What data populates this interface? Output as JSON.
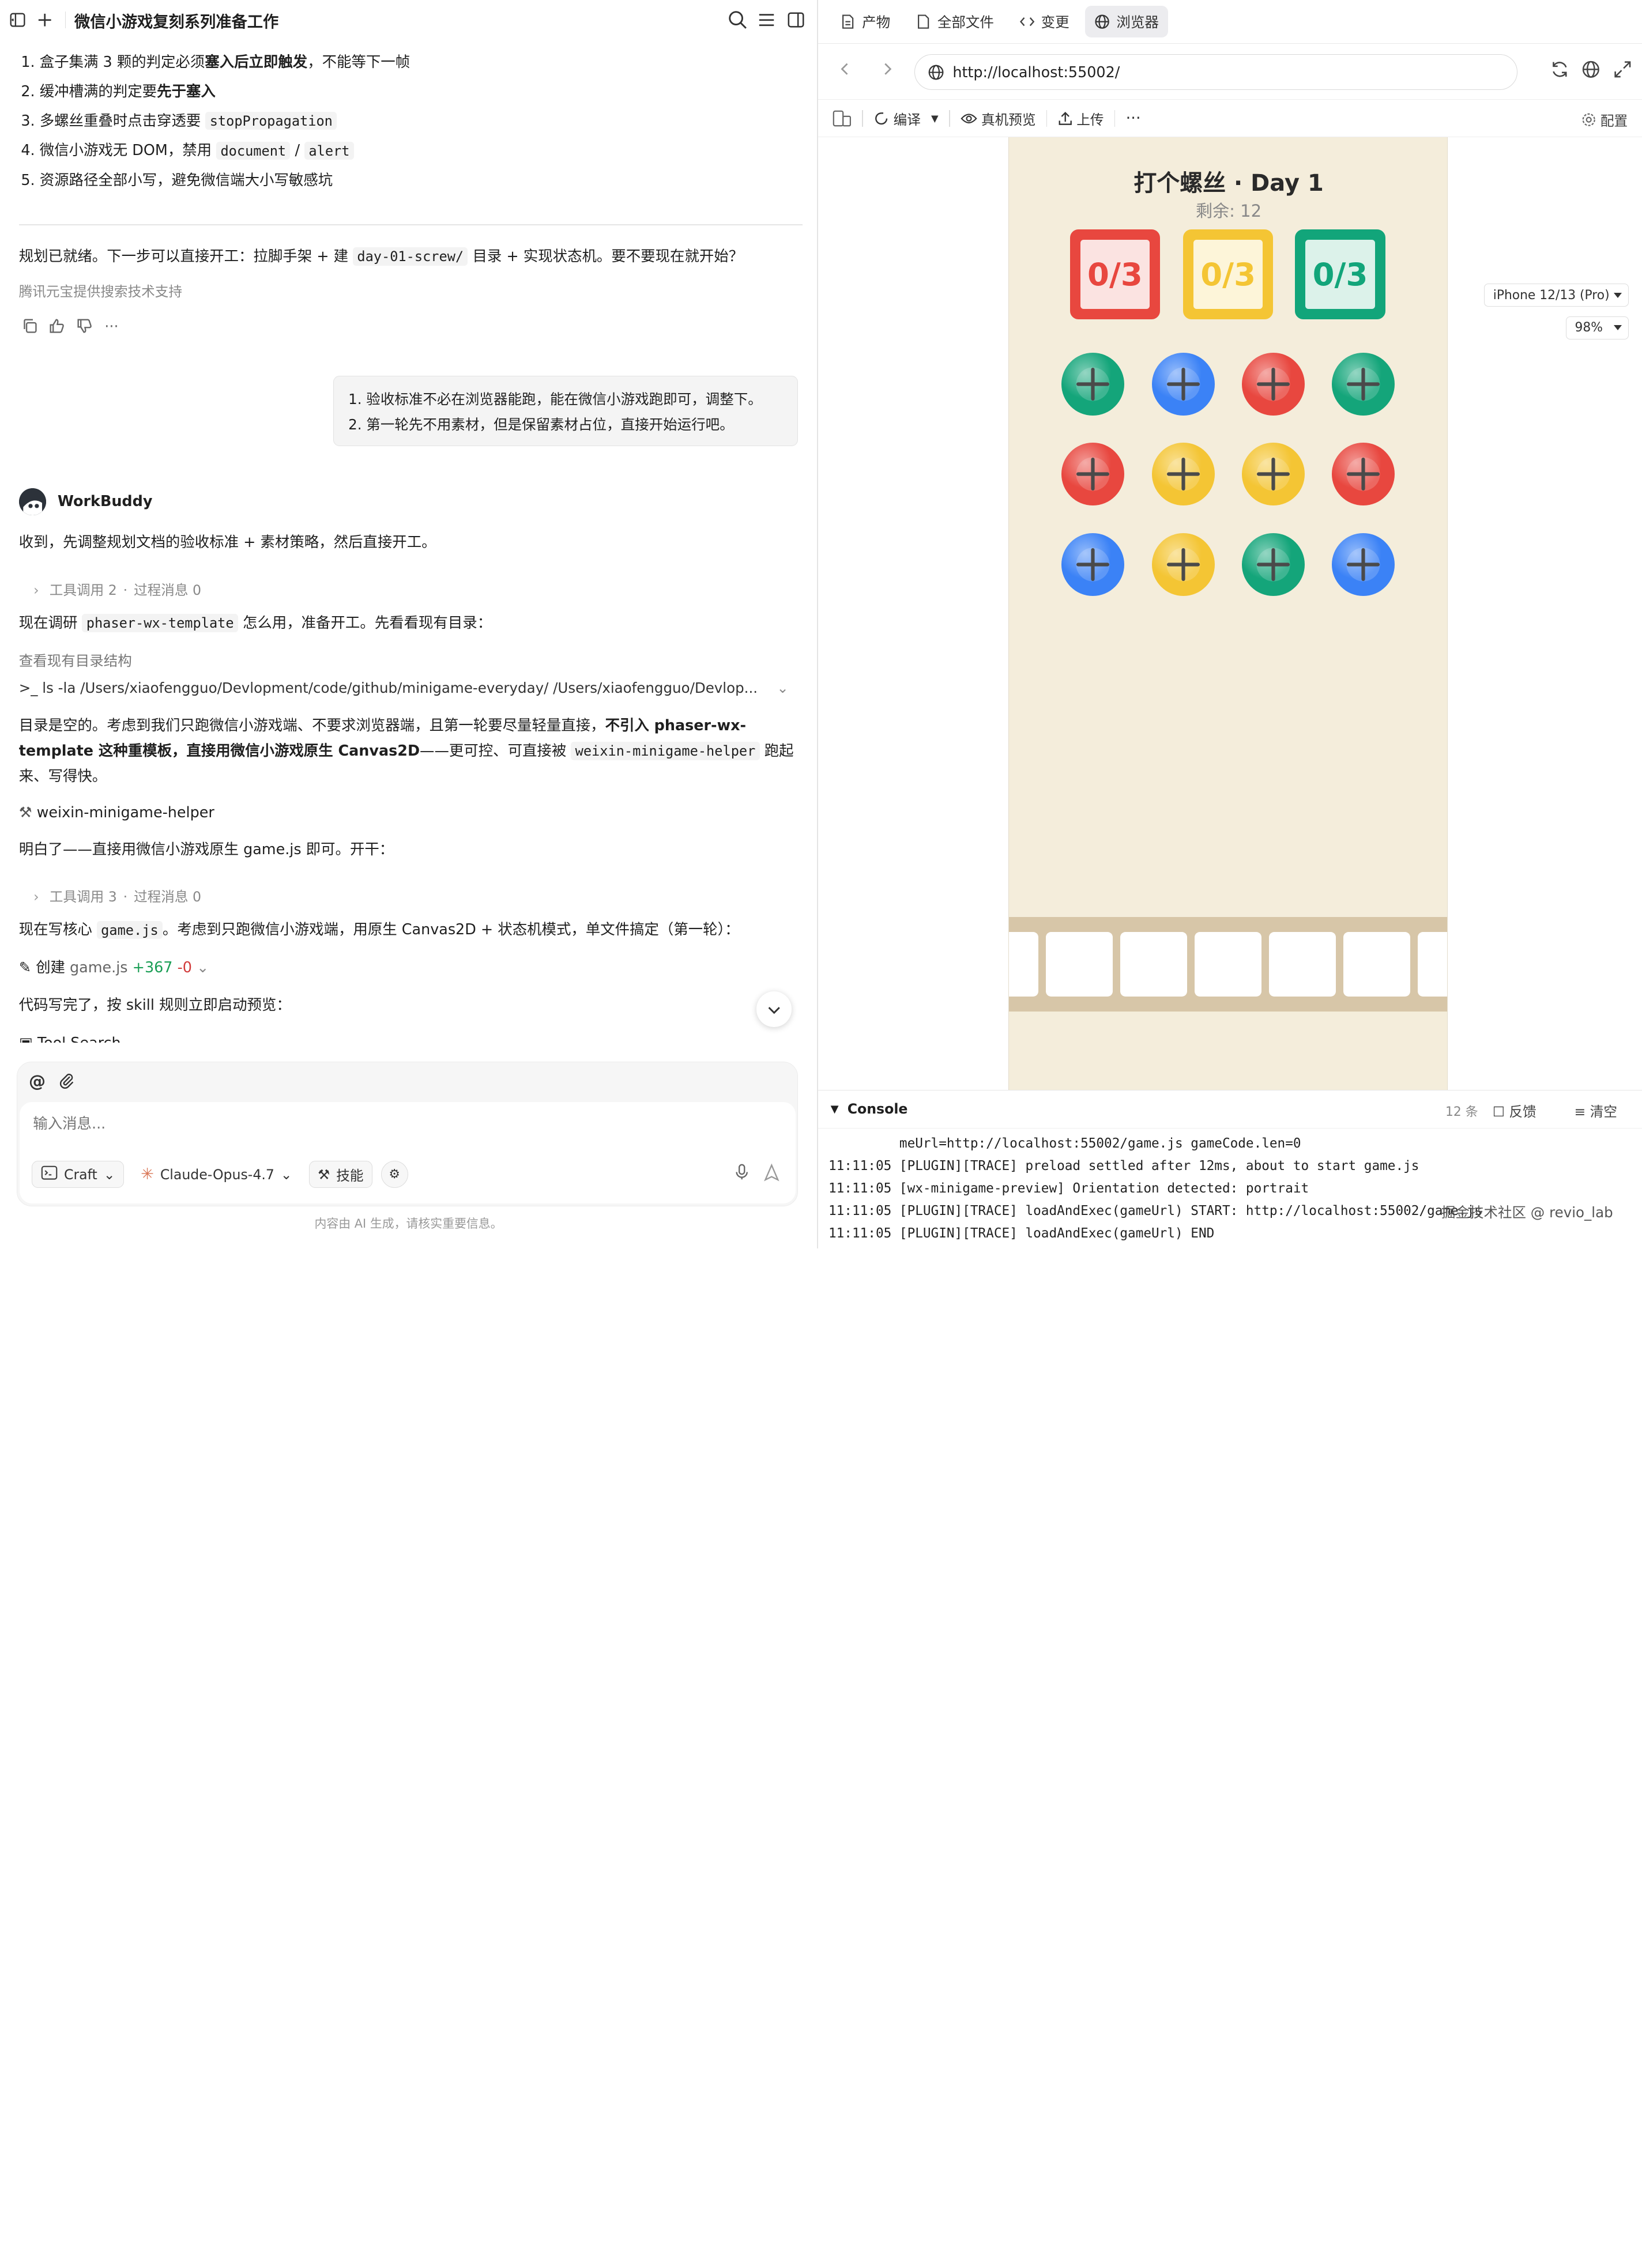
{
  "left": {
    "title": "微信小游戏复刻系列准备工作",
    "list": [
      {
        "n": "1.",
        "a": "盒子集满 3 颗的判定必须",
        "b": "塞入后立即触发",
        "c": "，不能等下一帧"
      },
      {
        "n": "2.",
        "a": "缓冲槽满的判定要",
        "b": "先于塞入",
        "c": ""
      },
      {
        "n": "3.",
        "a": "多螺丝重叠时点击穿透要 ",
        "code": "stopPropagation"
      },
      {
        "n": "4.",
        "a": "微信小游戏无 DOM，禁用 ",
        "code": "document",
        "mid": " / ",
        "code2": "alert"
      },
      {
        "n": "5.",
        "a": "资源路径全部小写，避免微信端大小写敏感坑"
      }
    ],
    "ready_a": "规划已就绪。下一步可以直接开工：拉脚手架 + 建 ",
    "ready_code": "day-01-screw/",
    "ready_b": " 目录 + 实现状态机。要不要现在就开始？",
    "powered": "腾讯元宝提供搜索技术支持",
    "user_msg": [
      "1. 验收标准不必在浏览器能跑，能在微信小游戏跑即可，调整下。",
      "2. 第一轮先不用素材，但是保留素材占位，直接开始运行吧。"
    ],
    "agent_name": "WorkBuddy",
    "m1": "收到，先调整规划文档的验收标准 + 素材策略，然后直接开工。",
    "tool1": {
      "label": "工具调用",
      "count": "2",
      "proc": "过程消息",
      "pcount": "0"
    },
    "m2a": "现在调研 ",
    "m2code": "phaser-wx-template",
    "m2b": " 怎么用，准备开工。先看看现有目录：",
    "step_label": "查看现有目录结构",
    "cmd": "ls -la /Users/xiaofengguo/Devlopment/code/github/minigame-everyday/ /Users/xiaofengguo/Devlop...",
    "m3_l1a": "目录是空的。考虑到我们只跑微信小游戏端、不要求浏览器端，且第一轮要尽量轻量直接，",
    "m3_l1b": "不引入 phaser-wx-",
    "m3_l2a": "template 这种重模板，直接用微信小游戏原生 Canvas2D",
    "m3_l2b": "——更可控、可直接被 ",
    "m3_l2code": "weixin-minigame-helper",
    "m3_l2c": " 跑起",
    "m3_l3": "来、写得快。",
    "skill": "weixin-minigame-helper",
    "m4": "明白了——直接用微信小游戏原生 game.js 即可。开干：",
    "tool2": {
      "label": "工具调用",
      "count": "3",
      "proc": "过程消息",
      "pcount": "0"
    },
    "m5a": "现在写核心 ",
    "m5code": "game.js",
    "m5b": "。考虑到只跑微信小游戏端，用原生 Canvas2D + 状态机模式，单文件搞定（第一轮）：",
    "create_label": "创建",
    "create_file": "game.js",
    "create_add": "+367",
    "create_del": "-0",
    "m6": "代码写完了，按 skill 规则立即启动预览：",
    "m7": "Tool Search",
    "composer": {
      "placeholder": "输入消息...",
      "mode": "Craft",
      "model": "Claude-Opus-4.7",
      "skill_btn": "技能"
    },
    "disclaimer": "内容由 AI 生成，请核实重要信息。"
  },
  "right": {
    "tabs": [
      "产物",
      "全部文件",
      "变更",
      "浏览器"
    ],
    "url": "http://localhost:55002/",
    "toolbar": {
      "compile": "编译",
      "preview": "真机预览",
      "upload": "上传",
      "config": "配置"
    },
    "device": "iPhone 12/13 (Pro)",
    "zoom": "98%",
    "game": {
      "title": "打个螺丝 · Day 1",
      "remaining": "剩余: 12",
      "boxes": [
        {
          "label": "0/3",
          "color": "#e8473f",
          "bg": "#fbe3e1"
        },
        {
          "label": "0/3",
          "color": "#f4c534",
          "bg": "#fdf5d9"
        },
        {
          "label": "0/3",
          "color": "#12a57a",
          "bg": "#dcf2ea"
        }
      ],
      "screws": [
        [
          "green",
          "blue",
          "red",
          "green"
        ],
        [
          "red",
          "yellow",
          "yellow",
          "red"
        ],
        [
          "blue",
          "yellow",
          "green",
          "blue"
        ]
      ],
      "colors": {
        "green": "#14a57a",
        "blue": "#3b82f6",
        "red": "#e8473f",
        "yellow": "#f4c534"
      }
    },
    "console": {
      "title": "Console",
      "count": "12 条",
      "feedback": "反馈",
      "clear": "清空",
      "logs": [
        {
          "time": "",
          "text": "meUrl=http://localhost:55002/game.js gameCode.len=0"
        },
        {
          "time": "11:11:05",
          "text": "[PLUGIN][TRACE] preload settled after 12ms, about to start game.js"
        },
        {
          "time": "11:11:05",
          "text": "[wx-minigame-preview] Orientation detected: portrait"
        },
        {
          "time": "11:11:05",
          "text": "[PLUGIN][TRACE] loadAndExec(gameUrl) START: http://localhost:55002/game.js"
        },
        {
          "time": "11:11:05",
          "text": "[PLUGIN][TRACE] loadAndExec(gameUrl) END"
        }
      ],
      "watermark": "掘金技术社区 @ revio_lab"
    }
  }
}
